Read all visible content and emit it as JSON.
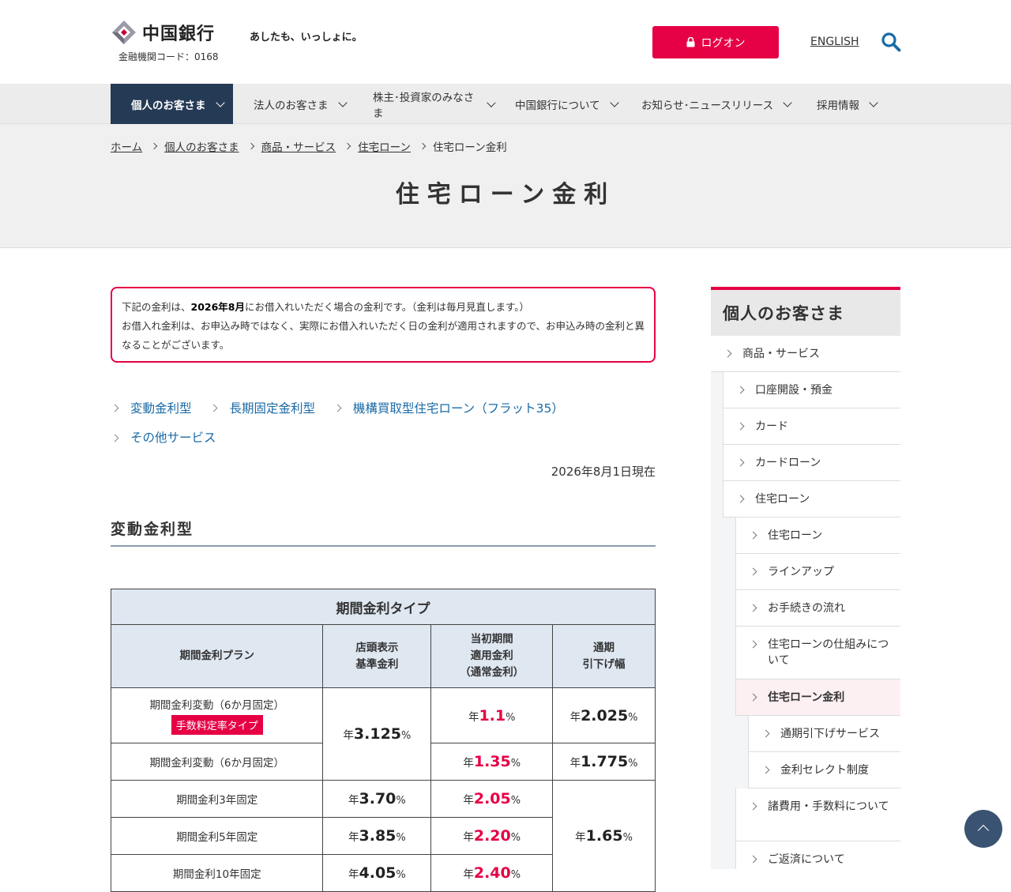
{
  "header": {
    "logo_text": "中国銀行",
    "bank_code": "金融機関コード：0168",
    "tagline": "あしたも、いっしょに。",
    "login_label": "ログオン",
    "english_label": "ENGLISH"
  },
  "nav": {
    "items": [
      {
        "label": "個人のお客さま"
      },
      {
        "label": "法人のお客さま"
      },
      {
        "label": "株主･投資家のみなさま"
      },
      {
        "label": "中国銀行について"
      },
      {
        "label": "お知らせ･ニュースリリース"
      },
      {
        "label": "採用情報"
      }
    ]
  },
  "breadcrumb": {
    "items": [
      "ホーム",
      "個人のお客さま",
      "商品・サービス",
      "住宅ローン"
    ],
    "current": "住宅ローン金利"
  },
  "page_title": "住宅ローン金利",
  "notice": {
    "line1_pre": "下記の金利は、",
    "line1_bold": "2026年8月",
    "line1_post": "にお借入れいただく場合の金利です。（金利は毎月見直します。）",
    "line2": "お借入れ金利は、お申込み時ではなく、実際にお借入れいただく日の金利が適用されますので、お申込み時の金利と異なることがございます。"
  },
  "anchors": [
    "変動金利型",
    "長期固定金利型",
    "機構買取型住宅ローン（フラット35）",
    "その他サービス"
  ],
  "as_of": "2026年8月1日現在",
  "section_title": "変動金利型",
  "table": {
    "caption": "期間金利タイプ",
    "headers": [
      "期間金利プラン",
      "店頭表示\n基準金利",
      "当初期間\n適用金利\n（通常金利）",
      "通期\n引下げ幅"
    ],
    "year_prefix": "年",
    "percent": "%",
    "rows": [
      {
        "plan": "期間金利変動（6か月固定）",
        "tag": "手数料定率タイプ",
        "base": "3.125",
        "initial": "1.1",
        "reduction": "2.025"
      },
      {
        "plan": "期間金利変動（6か月固定）",
        "initial": "1.35",
        "reduction": "1.775"
      },
      {
        "plan": "期間金利3年固定",
        "base": "3.70",
        "initial": "2.05",
        "reduction": "1.65"
      },
      {
        "plan": "期間金利5年固定",
        "base": "3.85",
        "initial": "2.20"
      },
      {
        "plan": "期間金利10年固定",
        "base": "4.05",
        "initial": "2.40"
      }
    ]
  },
  "sidebar": {
    "title": "個人のお客さま",
    "items": [
      {
        "label": "商品・サービス"
      },
      {
        "label": "口座開設・預金"
      },
      {
        "label": "カード"
      },
      {
        "label": "カードローン"
      },
      {
        "label": "住宅ローン"
      },
      {
        "label": "住宅ローン"
      },
      {
        "label": "ラインアップ"
      },
      {
        "label": "お手続きの流れ"
      },
      {
        "label": "住宅ローンの仕組みについて"
      },
      {
        "label": "住宅ローン金利"
      },
      {
        "label": "通期引下げサービス"
      },
      {
        "label": "金利セレクト制度"
      },
      {
        "label": "諸費用・手数料について"
      },
      {
        "label": "ご返済について"
      }
    ]
  },
  "colors": {
    "accent": "#e60044",
    "nav_active": "#253a55",
    "link": "#1a6aa6"
  }
}
